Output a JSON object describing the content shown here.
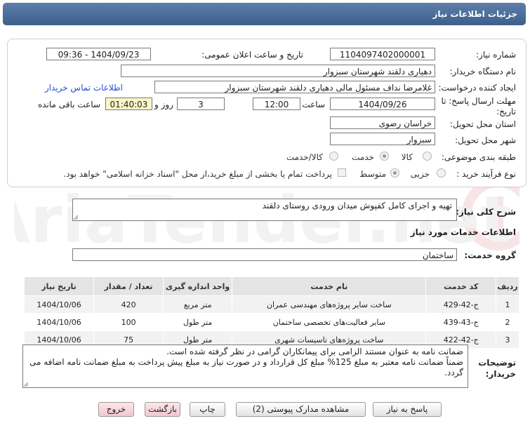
{
  "header": {
    "title": "جزئیات اطلاعات نیاز"
  },
  "form": {
    "need_number_label": "شماره نیاز:",
    "need_number": "1104097402000001",
    "announce_label": "تاریخ و ساعت اعلان عمومی:",
    "announce_value": "1404/09/23 - 09:36",
    "buyer_org_label": "نام دستگاه خریدار:",
    "buyer_org": "دهیاری دلقند شهرستان سبزوار",
    "creator_label": "ایجاد کننده درخواست:",
    "creator": "غلامرضا نداف مسئول مالی دهیاری دلقند شهرستان سبزوار",
    "contact_link": "اطلاعات تماس خریدار",
    "deadline_label_1": "مهلت ارسال پاسخ: تا",
    "deadline_label_2": "تاریخ:",
    "deadline_date": "1404/09/26",
    "time_label": "ساعت",
    "deadline_time": "12:00",
    "days": "3",
    "days_label": "روز و",
    "remaining": "01:40:03",
    "remaining_label": "ساعت باقی مانده",
    "province_label": "استان محل تحویل:",
    "province": "خراسان رضوی",
    "city_label": "شهر محل تحویل:",
    "city": "سبزوار",
    "category_label": "طبقه بندی موضوعی:",
    "category_options": [
      "کالا",
      "خدمت",
      "کالا/خدمت"
    ],
    "category_selected": "خدمت",
    "purchase_label": "نوع فرآیند خرید :",
    "purchase_options": [
      "جزیی",
      "متوسط"
    ],
    "purchase_selected": "متوسط",
    "treasury_note": "پرداخت تمام یا بخشی از مبلغ خرید،از محل \"اسناد خزانه اسلامی\" خواهد بود."
  },
  "summary": {
    "label": "شرح کلی نیاز:",
    "value": "تهیه و اجرای کامل کفپوش میدان ورودی روستای دلقند"
  },
  "services": {
    "section_title": "اطلاعات خدمات مورد نیاز",
    "group_label": "گروه خدمت:",
    "group_value": "ساختمان",
    "columns": [
      "ردیف",
      "کد خدمت",
      "نام خدمت",
      "واحد اندازه گیری",
      "تعداد / مقدار",
      "تاریخ نیاز"
    ],
    "rows": [
      {
        "idx": "1",
        "code": "ج-42-429",
        "name": "ساخت سایر پروژه‌های مهندسی عمران",
        "unit": "متر مربع",
        "qty": "420",
        "date": "1404/10/06"
      },
      {
        "idx": "2",
        "code": "ج-43-439",
        "name": "سایر فعالیت‌های تخصصی ساختمان",
        "unit": "متر طول",
        "qty": "100",
        "date": "1404/10/06"
      },
      {
        "idx": "3",
        "code": "ج-42-422",
        "name": "ساخت پروژه‌های تاسیسات شهری",
        "unit": "متر طول",
        "qty": "75",
        "date": "1404/10/06"
      }
    ]
  },
  "notes": {
    "label_1": "توضیحات",
    "label_2": "خریدار:",
    "line_1": "ضمانت نامه به عنوان مستند الزامی برای پیمانکاران گرامی در نظر گرفته شده است.",
    "line_2": "ضمناً ضمانت نامه معتبر به مبلغ 125% مبلغ کل قرارداد و در صورت نیاز به مبلغ پیش پرداخت به مبلغ ضمانت نامه اضافه می",
    "line_3": "گردد."
  },
  "watermark": "AriaTender.net",
  "buttons": {
    "respond": "پاسخ به نیاز",
    "view_docs": "مشاهده مدارک پیوستی (2)",
    "print": "چاپ",
    "back": "بازگشت",
    "exit": "خروج"
  }
}
